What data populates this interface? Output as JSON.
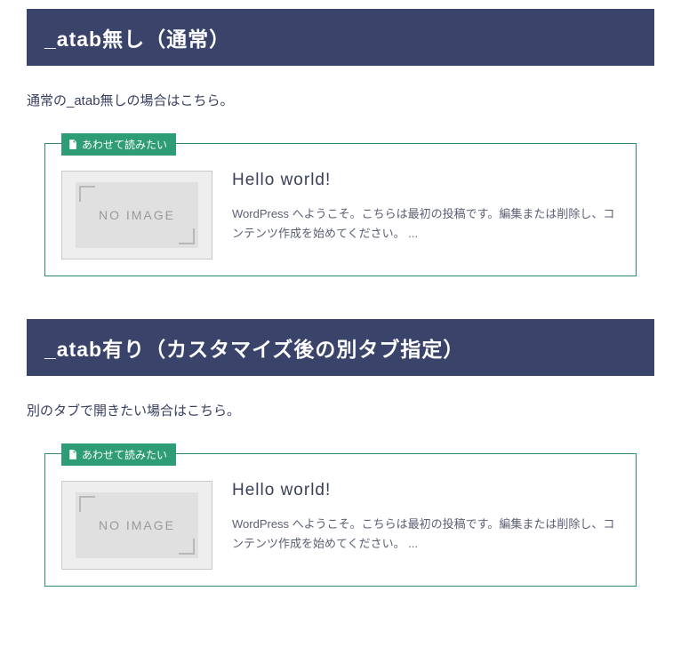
{
  "sections": [
    {
      "heading": "_atab無し（通常）",
      "text": "通常の_atab無しの場合はこちら。",
      "card": {
        "badge": "あわせて読みたい",
        "thumbnail_text": "NO IMAGE",
        "title": "Hello world!",
        "excerpt": "WordPress へようこそ。こちらは最初の投稿です。編集または削除し、コンテンツ作成を始めてください。 ..."
      }
    },
    {
      "heading": "_atab有り（カスタマイズ後の別タブ指定）",
      "text": "別のタブで開きたい場合はこちら。",
      "card": {
        "badge": "あわせて読みたい",
        "thumbnail_text": "NO IMAGE",
        "title": "Hello world!",
        "excerpt": "WordPress へようこそ。こちらは最初の投稿です。編集または削除し、コンテンツ作成を始めてください。 ..."
      }
    }
  ]
}
